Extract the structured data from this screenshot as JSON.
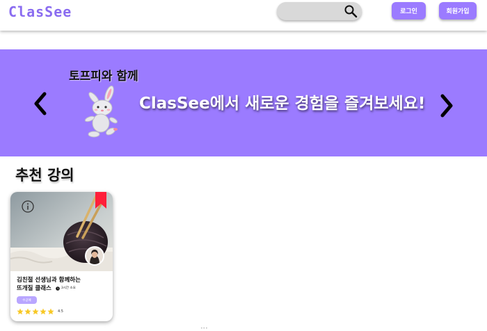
{
  "header": {
    "logo": "ClasSee",
    "search": {
      "placeholder": ""
    },
    "login_label": "로그인",
    "signup_label": "회원가입"
  },
  "banner": {
    "subtitle": "토프피와 함께",
    "title": "ClasSee에서 새로운 경험을 즐겨보세요!"
  },
  "section": {
    "title": "추천 강의"
  },
  "courses": [
    {
      "title_line1": "김친절 선생님과 함께하는",
      "title_line2": "뜨개질 클래스",
      "duration": "3시간 소요",
      "tag": "수공예",
      "rating": "4.5",
      "stars": 5,
      "bookmarked": true
    }
  ],
  "colors": {
    "brand": "#9b7bff",
    "banner_bg": "#9b7bff",
    "logo": "#8a6cf0",
    "button": "#9b7bff",
    "bookmark": "#ff1f3a",
    "tag": "#b9a6ff",
    "star": "#f7c825"
  },
  "icons": {
    "search": "search-icon",
    "prev": "chevron-left-icon",
    "next": "chevron-right-icon",
    "info": "info-icon",
    "bookmark": "bookmark-icon",
    "clock": "clock-icon",
    "star": "star-icon",
    "mascot": "bunny-mascot-illustration"
  }
}
